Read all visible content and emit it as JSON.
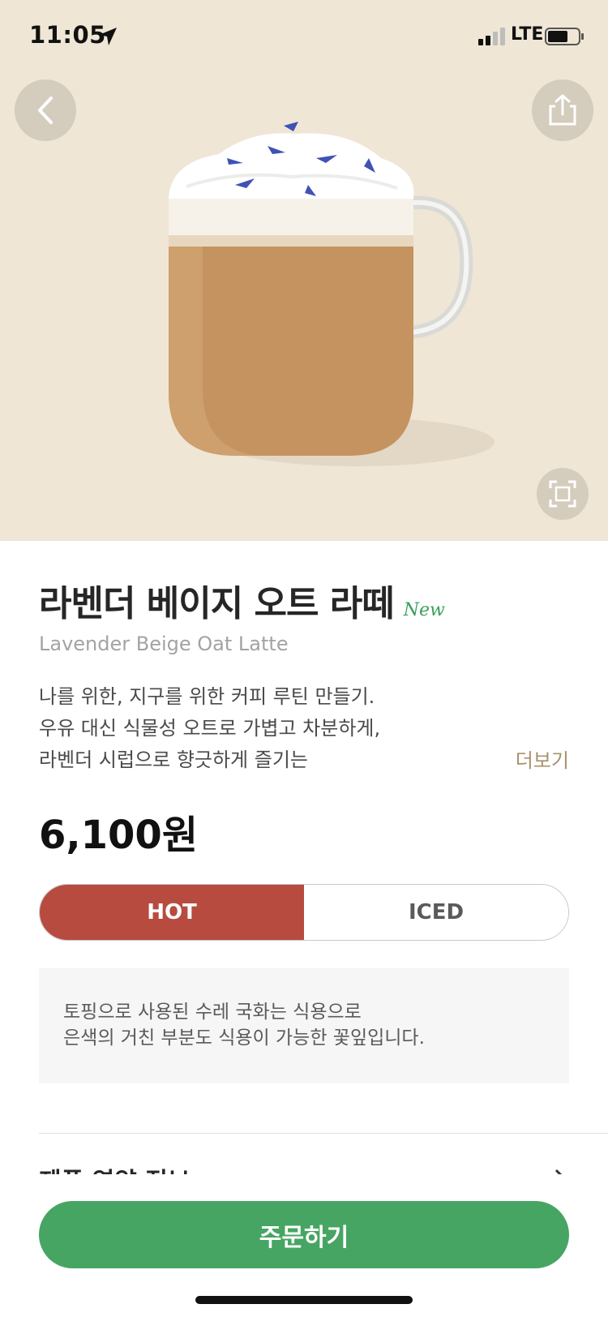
{
  "status_bar": {
    "time": "11:05",
    "network": "LTE",
    "icons": [
      "location-arrow-icon",
      "signal-icon",
      "battery-icon"
    ]
  },
  "hero": {
    "background_color": "#efe6d5",
    "icons": [
      "chevron-left-icon",
      "share-icon",
      "expand-icon"
    ]
  },
  "product": {
    "name": "라벤더 베이지 오트 라떼",
    "badge": "New",
    "english_name": "Lavender Beige Oat Latte",
    "description_lines": [
      "나를 위한, 지구를 위한 커피 루틴 만들기.",
      "우유 대신 식물성 오트로 가볍고 차분하게,",
      "라벤더 시럽으로 향긋하게 즐기는"
    ],
    "more_label": "더보기",
    "price": "6,100원"
  },
  "temperature": {
    "options": [
      "HOT",
      "ICED"
    ],
    "selected": "HOT",
    "selected_color": "#b84b3f"
  },
  "notice_lines": [
    "토핑으로 사용된 수레 국화는 식용으로",
    "은색의 거친 부분도 식용이 가능한 꽃잎입니다."
  ],
  "nutrition": {
    "label": "제품 영양 정보"
  },
  "order": {
    "label": "주문하기",
    "color": "#47a563"
  }
}
